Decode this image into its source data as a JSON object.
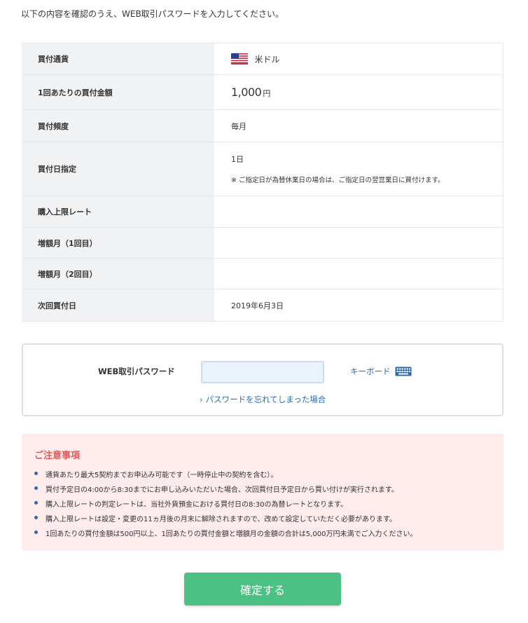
{
  "intro_text": "以下の内容を確認のうえ、WEB取引パスワードを入力してください。",
  "summary": {
    "currency": {
      "label": "買付通貨",
      "value": "米ドル",
      "icon": "us-flag-icon"
    },
    "amount": {
      "label": "1回あたりの買付金額",
      "number": "1,000",
      "unit": "円"
    },
    "frequency": {
      "label": "買付頻度",
      "value": "毎月"
    },
    "date_spec": {
      "label": "買付日指定",
      "value": "1日",
      "note": "※ ご指定日が為替休業日の場合は、ご指定日の翌営業日に買付けます。"
    },
    "upper_rate": {
      "label": "購入上限レート",
      "value": ""
    },
    "increase1": {
      "label": "増額月（1回目）",
      "value": ""
    },
    "increase2": {
      "label": "増額月（2回目）",
      "value": ""
    },
    "next_date": {
      "label": "次回買付日",
      "value": "2019年6月3日"
    }
  },
  "password": {
    "label": "WEB取引パスワード",
    "placeholder": "",
    "keyboard_label": "キーボード",
    "forgot_label": "パスワードを忘れてしまった場合"
  },
  "notice": {
    "title": "ご注意事項",
    "items": [
      "通貨あたり最大5契約までお申込み可能です（一時停止中の契約を含む）。",
      "買付予定日の4:00から8:30までにお申し込みいただいた場合、次回買付日予定日から買い付けが実行されます。",
      "購入上限レートの判定レートは、当社外貨預金における買付日の8:30の為替レートとなります。",
      "購入上限レートは設定・変更の11ヵ月後の月末に解除されますので、改めて設定していただく必要があります。",
      "1回あたりの買付金額は500円以上、1回あたりの買付金額と増額月の金額の合計は5,000万円未満でご入力ください。"
    ]
  },
  "confirm_label": "確定する",
  "colors": {
    "accent": "#4cc184",
    "link": "#2a6bb3",
    "notice_bg": "#fdeceb",
    "notice_title": "#e05a5a"
  }
}
